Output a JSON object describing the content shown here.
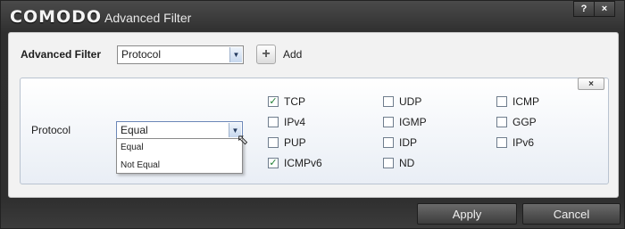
{
  "window": {
    "brand": "COMODO",
    "title": "Advanced Filter",
    "help_button": "?",
    "close_button": "×"
  },
  "filter": {
    "label": "Advanced Filter",
    "selected": "Protocol",
    "add_label": "Add",
    "add_icon": "+"
  },
  "criteria": {
    "remove_label": "×",
    "field_label": "Protocol",
    "operator_selected": "Equal",
    "operator_options": [
      "Equal",
      "Not Equal"
    ]
  },
  "protocols": [
    {
      "label": "TCP",
      "checked": true
    },
    {
      "label": "UDP",
      "checked": false
    },
    {
      "label": "ICMP",
      "checked": false
    },
    {
      "label": "IPv4",
      "checked": false
    },
    {
      "label": "IGMP",
      "checked": false
    },
    {
      "label": "GGP",
      "checked": false
    },
    {
      "label": "PUP",
      "checked": false
    },
    {
      "label": "IDP",
      "checked": false
    },
    {
      "label": "IPv6",
      "checked": false
    },
    {
      "label": "ICMPv6",
      "checked": true
    },
    {
      "label": "ND",
      "checked": false
    }
  ],
  "footer": {
    "apply": "Apply",
    "cancel": "Cancel"
  }
}
